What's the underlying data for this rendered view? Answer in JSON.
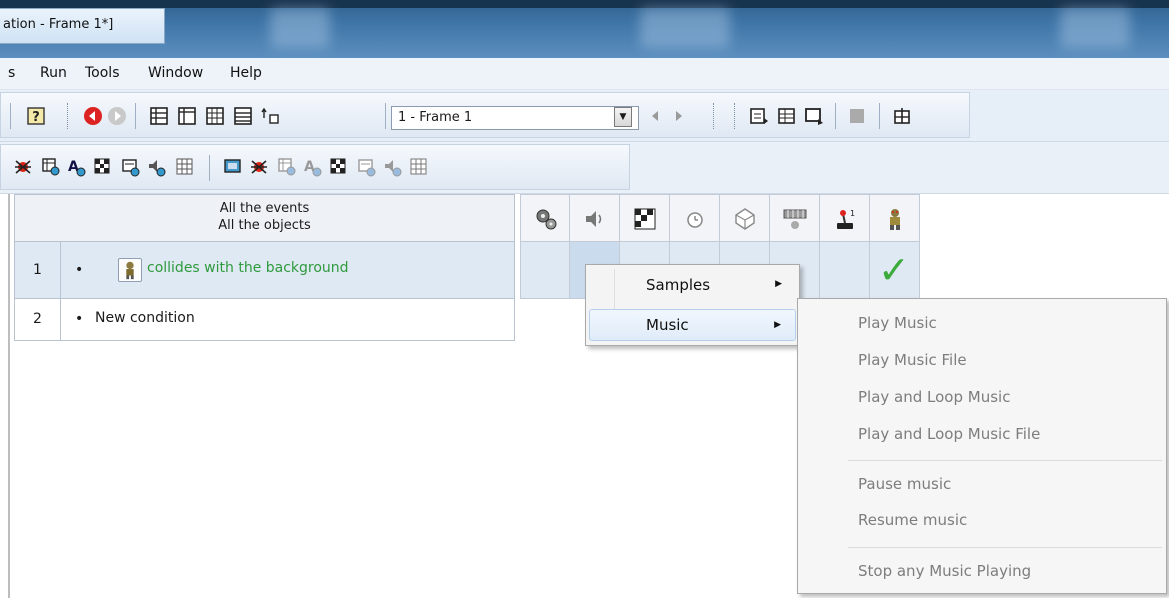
{
  "window": {
    "title": "ation - Frame 1*]"
  },
  "menubar": {
    "items": [
      "s",
      "Run",
      "Tools",
      "Window",
      "Help"
    ]
  },
  "toolbar": {
    "frame_selector_value": "1 - Frame 1",
    "icons": [
      "help-icon",
      "back-icon",
      "forward-icon",
      "view-list-icon",
      "view-frame-icon",
      "grid-icon",
      "list-icon",
      "insert-frame-icon",
      "prev-icon",
      "next-icon",
      "editor-1-icon",
      "editor-2-icon",
      "editor-3-icon",
      "stop-icon",
      "tile-icon"
    ]
  },
  "toolbar2": {
    "icons": [
      "object-bug-icon",
      "object-grid-icon",
      "text-icon",
      "checker-icon",
      "picture-icon",
      "sound-icon",
      "table-icon",
      "screen-icon"
    ]
  },
  "events": {
    "header_line1": "All the events",
    "header_line2": "All the objects",
    "rows": [
      {
        "number": "1",
        "bullet": "•",
        "condition": "collides with the background"
      },
      {
        "number": "2",
        "bullet": "•",
        "condition": "New condition"
      }
    ]
  },
  "object_columns": [
    "special-conditions-icon",
    "sound-icon",
    "storyboard-icon",
    "timer-icon",
    "create-objects-icon",
    "keyboard-mouse-icon",
    "player-icon",
    "character-object-icon"
  ],
  "row1_check": "✓",
  "context_menu": {
    "items": [
      {
        "label": "Samples",
        "arrow": "▶"
      },
      {
        "label": "Music",
        "arrow": "▶"
      }
    ]
  },
  "submenu": {
    "items": [
      "Play Music",
      "Play Music File",
      "Play and Loop Music",
      "Play and Loop Music File",
      "Pause music",
      "Resume music",
      "Stop any Music Playing"
    ]
  },
  "colors": {
    "title_bar": "#3f76a8",
    "condition_text": "#2f9a3d",
    "disabled_text": "#7d7d7d",
    "checkmark": "#3cab3c"
  }
}
